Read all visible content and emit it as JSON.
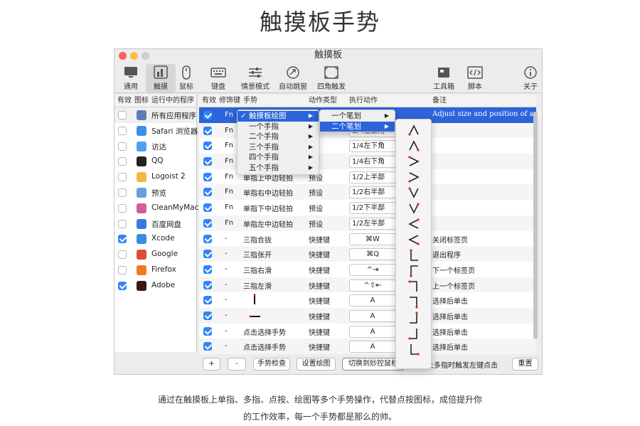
{
  "page": {
    "title": "触摸板手势",
    "caption_line1": "通过在触摸板上单指、多指、点按、绘图等多个手势操作，代替点按图标，成倍提升你",
    "caption_line2": "的工作效率，每一个手势都是那么的帅。"
  },
  "window": {
    "title": "触摸板"
  },
  "toolbar": {
    "items": [
      {
        "label": "通用",
        "icon": "monitor-icon"
      },
      {
        "label": "触摸",
        "icon": "trackpad-icon",
        "active": true
      },
      {
        "label": "鼠标",
        "icon": "mouse-icon"
      },
      {
        "label": "键盘",
        "icon": "keyboard-icon"
      },
      {
        "label": "情景模式",
        "icon": "sliders-icon"
      },
      {
        "label": "自动跳窗",
        "icon": "jump-icon"
      },
      {
        "label": "四角触发",
        "icon": "corners-icon"
      },
      {
        "label": "工具箱",
        "icon": "toolbox-icon"
      },
      {
        "label": "脚本",
        "icon": "script-icon"
      },
      {
        "label": "关于",
        "icon": "info-icon"
      }
    ]
  },
  "apps_table": {
    "headers": {
      "enabled": "有效",
      "icon": "图标",
      "name": "运行中的程序"
    },
    "rows": [
      {
        "name": "所有应用程序",
        "enabled": false,
        "icon": "all-apps-icon",
        "color": "#5a7fb8"
      },
      {
        "name": "Safari 浏览器",
        "enabled": false,
        "icon": "safari-icon",
        "color": "#3f8fe8"
      },
      {
        "name": "访达",
        "enabled": false,
        "icon": "finder-icon",
        "color": "#4aa3f0"
      },
      {
        "name": "QQ",
        "enabled": false,
        "icon": "qq-icon",
        "color": "#222222"
      },
      {
        "name": "Logoist 2",
        "enabled": false,
        "icon": "logoist-icon",
        "color": "#f0b840"
      },
      {
        "name": "预览",
        "enabled": false,
        "icon": "preview-icon",
        "color": "#6aa0d8"
      },
      {
        "name": "CleanMyMac",
        "enabled": false,
        "icon": "cleanmymac-icon",
        "color": "#d85a9a"
      },
      {
        "name": "百度网盘",
        "enabled": false,
        "icon": "baidu-netdisk-icon",
        "color": "#3a78e0"
      },
      {
        "name": "Xcode",
        "enabled": true,
        "icon": "xcode-icon",
        "color": "#3b8de0"
      },
      {
        "name": "Google",
        "enabled": false,
        "icon": "chrome-icon",
        "color": "#e04a3a"
      },
      {
        "name": "Firefox",
        "enabled": false,
        "icon": "firefox-icon",
        "color": "#f07a20"
      },
      {
        "name": "Adobe",
        "enabled": true,
        "icon": "illustrator-icon",
        "color": "#3a1a0a"
      }
    ]
  },
  "gesture_table": {
    "headers": {
      "enabled": "有效",
      "modifier": "修饰键",
      "gesture": "手势",
      "type": "动作类型",
      "action": "执行动作",
      "note": "备注"
    },
    "rows": [
      {
        "enabled": true,
        "modifier": "Fn",
        "gesture": "",
        "type": "",
        "action": "",
        "note": "Adjust size and position of active",
        "highlight": true
      },
      {
        "enabled": true,
        "modifier": "Fn",
        "gesture": "",
        "type": "",
        "action": "1/4左上角",
        "note": ""
      },
      {
        "enabled": true,
        "modifier": "Fn",
        "gesture": "",
        "type": "设",
        "action": "1/4左下角",
        "note": ""
      },
      {
        "enabled": true,
        "modifier": "Fn",
        "gesture": "",
        "type": "设",
        "action": "1/4右下角",
        "note": ""
      },
      {
        "enabled": true,
        "modifier": "Fn",
        "gesture": "单指上中边轻拍",
        "type": "预设",
        "action": "1/2上半部",
        "note": ""
      },
      {
        "enabled": true,
        "modifier": "Fn",
        "gesture": "单指右中边轻拍",
        "type": "预设",
        "action": "1/2右半部",
        "note": ""
      },
      {
        "enabled": true,
        "modifier": "Fn",
        "gesture": "单指下中边轻拍",
        "type": "预设",
        "action": "1/2下半部",
        "note": ""
      },
      {
        "enabled": true,
        "modifier": "Fn",
        "gesture": "单指左中边轻拍",
        "type": "预设",
        "action": "1/2左半部",
        "note": ""
      },
      {
        "enabled": true,
        "modifier": "-",
        "gesture": "三指合拢",
        "type": "快捷键",
        "action": "⌘W",
        "note": "关闭标签页"
      },
      {
        "enabled": true,
        "modifier": "-",
        "gesture": "三指张开",
        "type": "快捷键",
        "action": "⌘Q",
        "note": "退出程序"
      },
      {
        "enabled": true,
        "modifier": "-",
        "gesture": "三指右滑",
        "type": "快捷键",
        "action": "^⇥",
        "note": "下一个标签页"
      },
      {
        "enabled": true,
        "modifier": "-",
        "gesture": "三指左滑",
        "type": "快捷键",
        "action": "^⇧⇤",
        "note": "上一个标签页"
      },
      {
        "enabled": true,
        "modifier": "-",
        "gesture": "",
        "gesture_glyph": "vertical",
        "type": "快捷键",
        "action": "A",
        "note": "选择后单击"
      },
      {
        "enabled": true,
        "modifier": "-",
        "gesture": "",
        "gesture_glyph": "horizontal",
        "type": "快捷键",
        "action": "A",
        "note": "选择后单击"
      },
      {
        "enabled": true,
        "modifier": "-",
        "gesture": "点击选择手势",
        "type": "快捷键",
        "action": "A",
        "note": "选择后单击"
      },
      {
        "enabled": true,
        "modifier": "-",
        "gesture": "点击选择手势",
        "type": "快捷键",
        "action": "A",
        "note": "选择后单击"
      }
    ]
  },
  "bottom_bar": {
    "add": "+",
    "remove": "-",
    "check": "手势检查",
    "settings": "设置绘图",
    "switch": "切换到妙控鼠标",
    "hint": "上多指时触发左键点击",
    "reset": "重置"
  },
  "menus": {
    "main": [
      {
        "label": "触摸板绘图",
        "checked": true,
        "active": true
      },
      {
        "label": "一个手指"
      },
      {
        "label": "二个手指"
      },
      {
        "label": "三个手指"
      },
      {
        "label": "四个手指"
      },
      {
        "label": "五个手指"
      }
    ],
    "sub": [
      {
        "label": "一个笔划"
      },
      {
        "label": "二个笔划",
        "active": true
      }
    ]
  },
  "colors": {
    "accent": "#2c64d9",
    "checkbox": "#2f86f5",
    "stroke_dot": "#d8291c"
  }
}
